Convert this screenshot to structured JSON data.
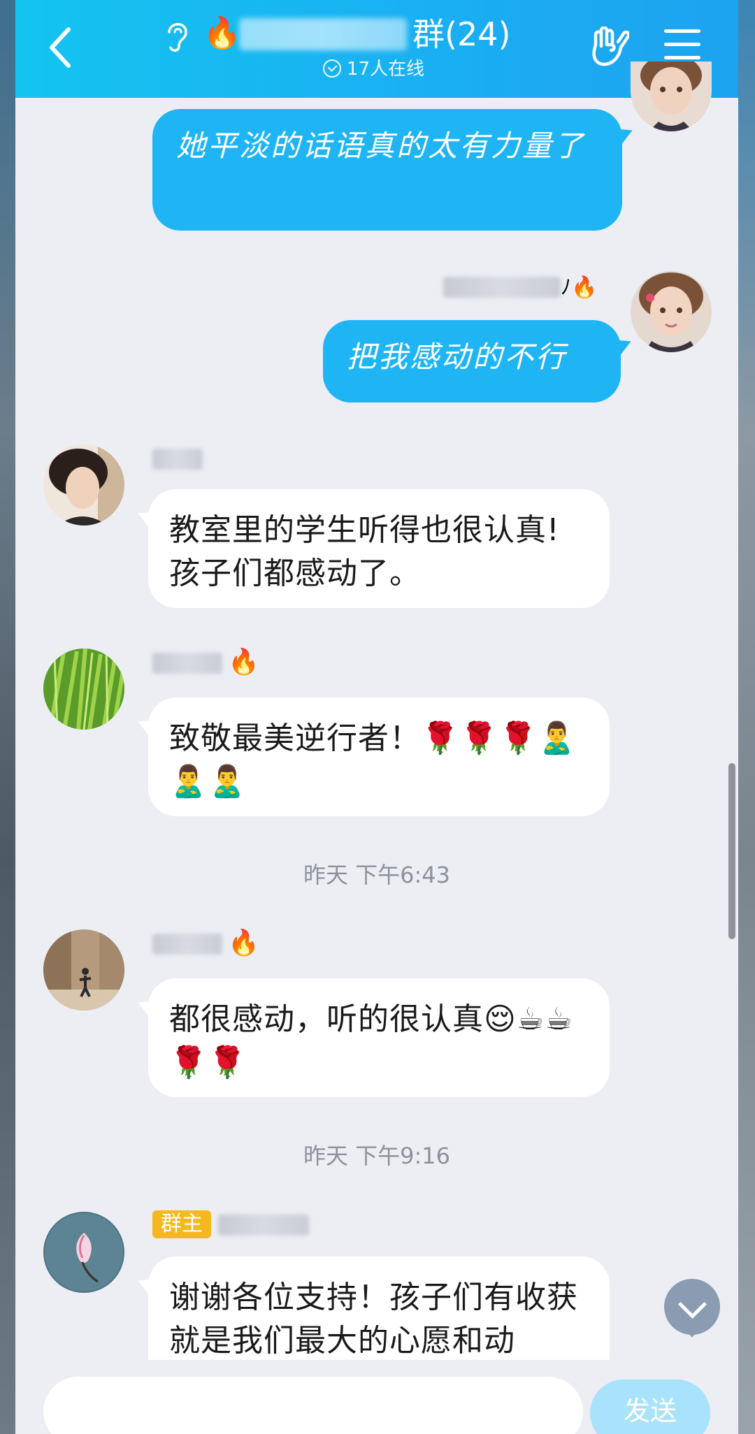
{
  "header": {
    "title_suffix": "群(24)",
    "online_status": "17人在线",
    "fire_emoji": "🔥"
  },
  "messages": {
    "out1": {
      "text": "她平淡的话语真的太有力量了"
    },
    "out2": {
      "nick_suffix": "ﾉ🔥",
      "text": "把我感动的不行"
    },
    "in1": {
      "text": "教室里的学生听得也很认真!孩子们都感动了。"
    },
    "in2": {
      "fire": "🔥",
      "text": "致敬最美逆行者！🌹🌹🌹🙎‍♂️🙎‍♂️🙎‍♂️"
    },
    "time1": "昨天 下午6:43",
    "in3": {
      "fire": "🔥",
      "text": "都很感动，听的很认真😌☕☕🌹🌹"
    },
    "time2": "昨天 下午9:16",
    "in4": {
      "badge": "群主",
      "text": "谢谢各位支持！孩子们有收获就是我们最大的心愿和动"
    }
  },
  "input": {
    "placeholder": "",
    "send_label": "发送"
  },
  "colors": {
    "header": "#1aaef2",
    "bubble_out": "#1fb5f5",
    "bubble_in": "#ffffff",
    "badge": "#f5b91f"
  }
}
